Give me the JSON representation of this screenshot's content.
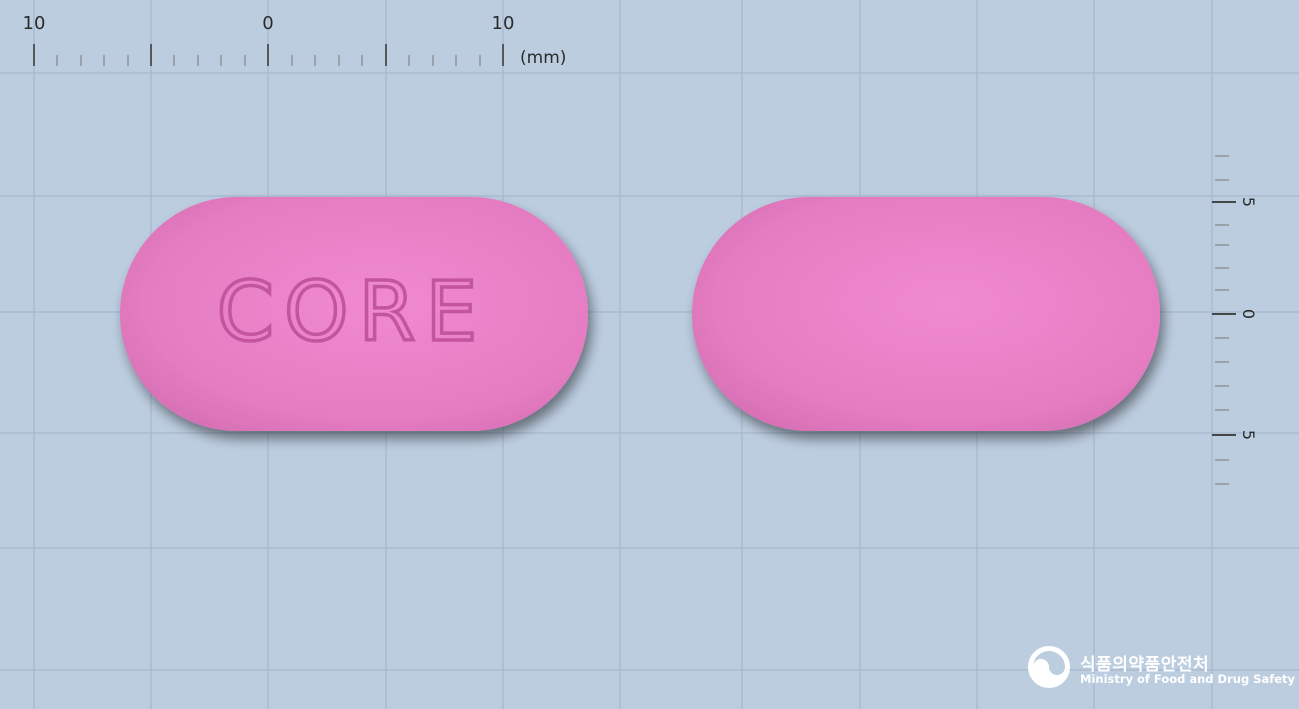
{
  "top_ruler": {
    "labels": [
      "10",
      "0",
      "10"
    ],
    "unit": "(mm)"
  },
  "side_ruler": {
    "labels": [
      "5",
      "0",
      "5"
    ]
  },
  "tablet": {
    "imprint_front": "CORE",
    "color": "#e97fc4",
    "shape": "oblong"
  },
  "logo": {
    "name_ko": "식품의약품안전처",
    "name_en": "Ministry of Food and Drug Safety"
  }
}
